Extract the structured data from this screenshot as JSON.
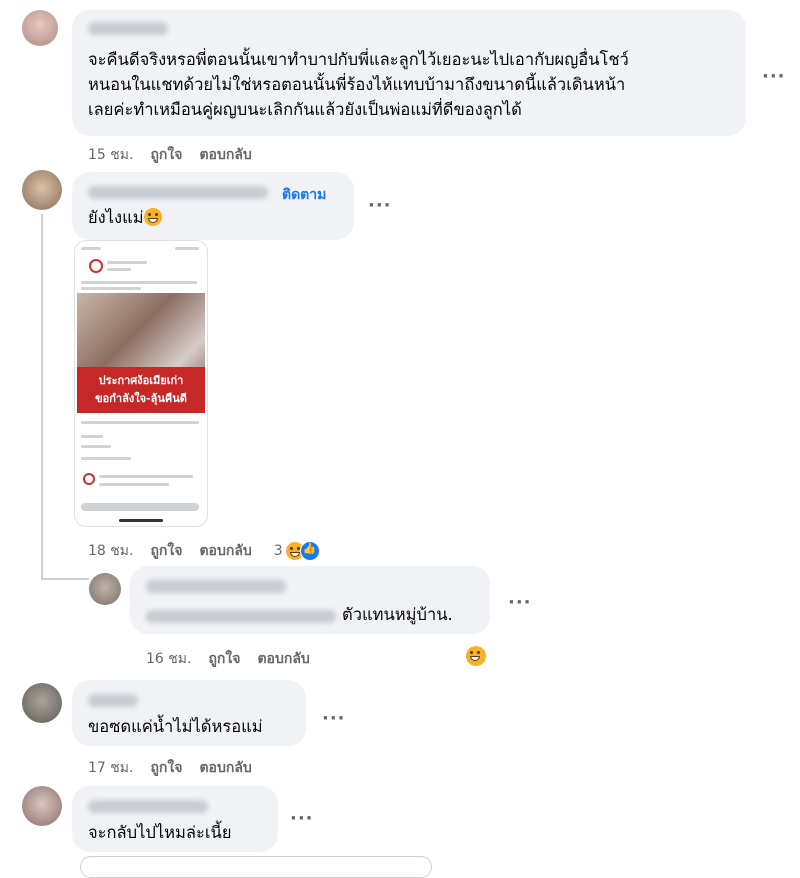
{
  "comments": [
    {
      "text_lines": [
        "จะคืนดีจริงหรอพี่ตอนนั้นเขาทำบาปกับพี่และลูกไว้เยอะนะไปเอากับผญอื่นโชว์",
        "หนอนในแชทด้วยไม่ใช่หรอตอนนั้นพี่ร้องไห้แทบบ้ามาถึงขนาดนี้แล้วเดินหน้า",
        "เลยค่ะทำเหมือนคู่ผญบนะเลิกกันแล้วยังเป็นพ่อแม่ที่ดีของลูกได้"
      ],
      "time": "15 ชม.",
      "like": "ถูกใจ",
      "reply": "ตอบกลับ"
    },
    {
      "text": "ยังไงแม่",
      "follow": "ติดตาม",
      "time": "18 ชม.",
      "like": "ถูกใจ",
      "reply": "ตอบกลับ",
      "reaction_count": "3",
      "screenshot": {
        "banner_line1": "ประกาศง้อเมียเก่า",
        "banner_line2": "ขอกำลังใจ-ลุ้นคืนดี"
      }
    },
    {
      "text": "ตัวแทนหมู่บ้าน.",
      "time": "16 ชม.",
      "like": "ถูกใจ",
      "reply": "ตอบกลับ"
    },
    {
      "text": "ขอซดแค่น้ำไม่ได้หรอแม่",
      "time": "17 ชม.",
      "like": "ถูกใจ",
      "reply": "ตอบกลับ"
    },
    {
      "text": "จะกลับไปไหมล่ะเนี้ย"
    }
  ],
  "more_icon": "···",
  "colors": {
    "bubble": "#f0f2f5",
    "link": "#1877f2",
    "meta": "#65676b"
  }
}
